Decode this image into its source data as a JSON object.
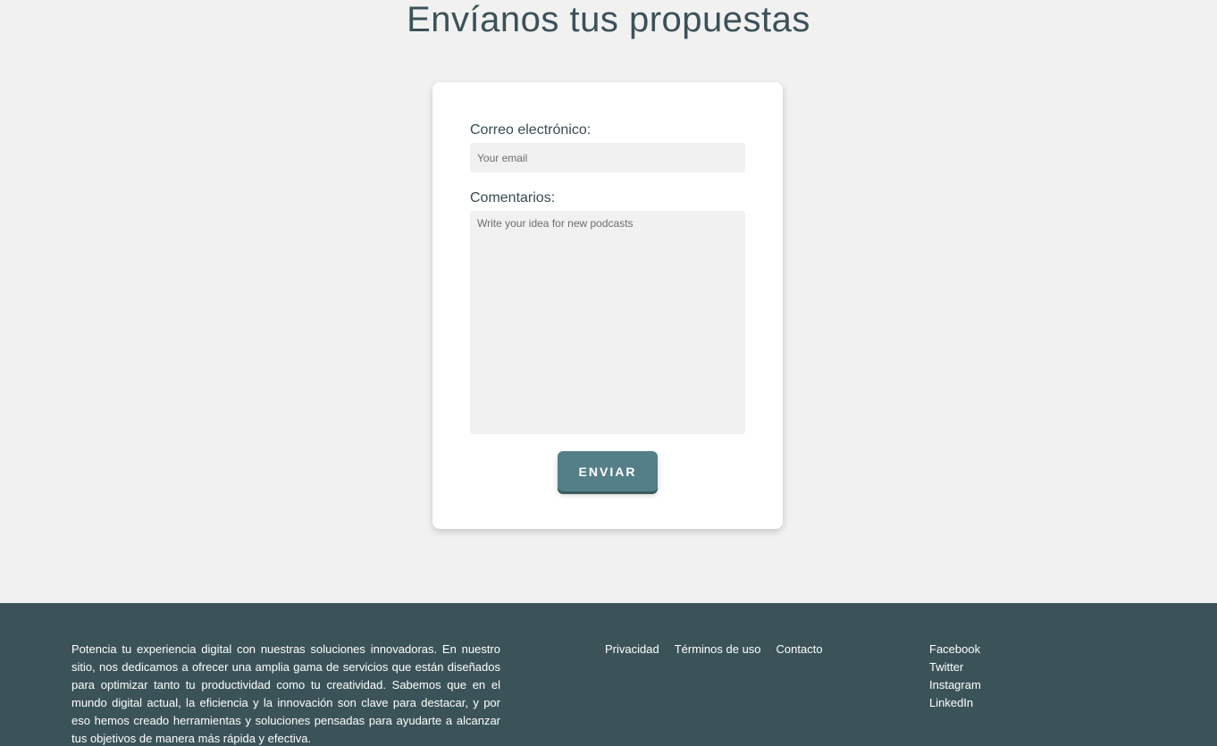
{
  "page": {
    "title": "Envíanos tus propuestas"
  },
  "form": {
    "email_label": "Correo electrónico:",
    "email_placeholder": "Your email",
    "email_value": "",
    "comments_label": "Comentarios:",
    "comments_placeholder": "Write your idea for new podcasts",
    "comments_value": "",
    "submit_label": "ENVIAR"
  },
  "footer": {
    "description": "Potencia tu experiencia digital con nuestras soluciones innovadoras. En nuestro sitio, nos dedicamos a ofrecer una amplia gama de servicios que están diseñados para optimizar tanto tu productividad como tu creatividad. Sabemos que en el mundo digital actual, la eficiencia y la innovación son clave para destacar, y por eso hemos creado herramientas y soluciones pensadas para ayudarte a alcanzar tus objetivos de manera más rápida y efectiva.",
    "links": [
      {
        "label": "Privacidad"
      },
      {
        "label": "Términos de uso"
      },
      {
        "label": "Contacto"
      }
    ],
    "social": [
      {
        "label": "Facebook"
      },
      {
        "label": "Twitter"
      },
      {
        "label": "Instagram"
      },
      {
        "label": "LinkedIn"
      }
    ]
  },
  "colors": {
    "background": "#f1f1f1",
    "card": "#ffffff",
    "accent_button": "#557f88",
    "footer": "#3b5358",
    "heading_text": "#3c5158"
  }
}
